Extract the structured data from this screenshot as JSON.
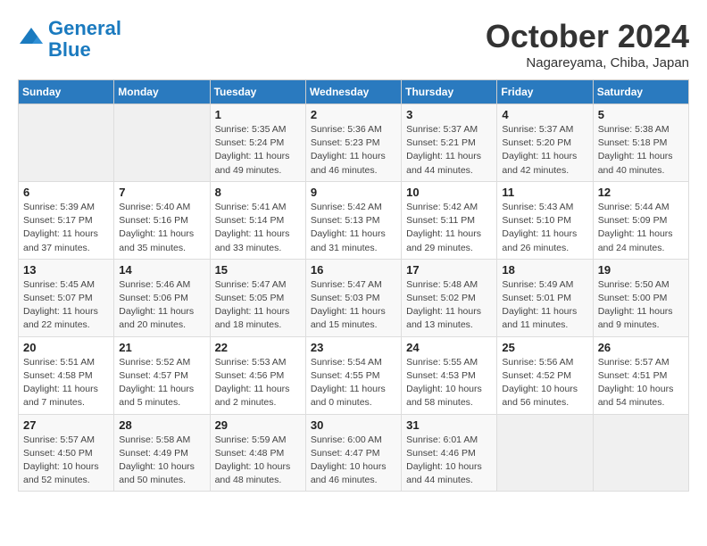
{
  "header": {
    "logo_line1": "General",
    "logo_line2": "Blue",
    "month": "October 2024",
    "location": "Nagareyama, Chiba, Japan"
  },
  "days_of_week": [
    "Sunday",
    "Monday",
    "Tuesday",
    "Wednesday",
    "Thursday",
    "Friday",
    "Saturday"
  ],
  "weeks": [
    [
      {
        "day": "",
        "info": ""
      },
      {
        "day": "",
        "info": ""
      },
      {
        "day": "1",
        "info": "Sunrise: 5:35 AM\nSunset: 5:24 PM\nDaylight: 11 hours and 49 minutes."
      },
      {
        "day": "2",
        "info": "Sunrise: 5:36 AM\nSunset: 5:23 PM\nDaylight: 11 hours and 46 minutes."
      },
      {
        "day": "3",
        "info": "Sunrise: 5:37 AM\nSunset: 5:21 PM\nDaylight: 11 hours and 44 minutes."
      },
      {
        "day": "4",
        "info": "Sunrise: 5:37 AM\nSunset: 5:20 PM\nDaylight: 11 hours and 42 minutes."
      },
      {
        "day": "5",
        "info": "Sunrise: 5:38 AM\nSunset: 5:18 PM\nDaylight: 11 hours and 40 minutes."
      }
    ],
    [
      {
        "day": "6",
        "info": "Sunrise: 5:39 AM\nSunset: 5:17 PM\nDaylight: 11 hours and 37 minutes."
      },
      {
        "day": "7",
        "info": "Sunrise: 5:40 AM\nSunset: 5:16 PM\nDaylight: 11 hours and 35 minutes."
      },
      {
        "day": "8",
        "info": "Sunrise: 5:41 AM\nSunset: 5:14 PM\nDaylight: 11 hours and 33 minutes."
      },
      {
        "day": "9",
        "info": "Sunrise: 5:42 AM\nSunset: 5:13 PM\nDaylight: 11 hours and 31 minutes."
      },
      {
        "day": "10",
        "info": "Sunrise: 5:42 AM\nSunset: 5:11 PM\nDaylight: 11 hours and 29 minutes."
      },
      {
        "day": "11",
        "info": "Sunrise: 5:43 AM\nSunset: 5:10 PM\nDaylight: 11 hours and 26 minutes."
      },
      {
        "day": "12",
        "info": "Sunrise: 5:44 AM\nSunset: 5:09 PM\nDaylight: 11 hours and 24 minutes."
      }
    ],
    [
      {
        "day": "13",
        "info": "Sunrise: 5:45 AM\nSunset: 5:07 PM\nDaylight: 11 hours and 22 minutes."
      },
      {
        "day": "14",
        "info": "Sunrise: 5:46 AM\nSunset: 5:06 PM\nDaylight: 11 hours and 20 minutes."
      },
      {
        "day": "15",
        "info": "Sunrise: 5:47 AM\nSunset: 5:05 PM\nDaylight: 11 hours and 18 minutes."
      },
      {
        "day": "16",
        "info": "Sunrise: 5:47 AM\nSunset: 5:03 PM\nDaylight: 11 hours and 15 minutes."
      },
      {
        "day": "17",
        "info": "Sunrise: 5:48 AM\nSunset: 5:02 PM\nDaylight: 11 hours and 13 minutes."
      },
      {
        "day": "18",
        "info": "Sunrise: 5:49 AM\nSunset: 5:01 PM\nDaylight: 11 hours and 11 minutes."
      },
      {
        "day": "19",
        "info": "Sunrise: 5:50 AM\nSunset: 5:00 PM\nDaylight: 11 hours and 9 minutes."
      }
    ],
    [
      {
        "day": "20",
        "info": "Sunrise: 5:51 AM\nSunset: 4:58 PM\nDaylight: 11 hours and 7 minutes."
      },
      {
        "day": "21",
        "info": "Sunrise: 5:52 AM\nSunset: 4:57 PM\nDaylight: 11 hours and 5 minutes."
      },
      {
        "day": "22",
        "info": "Sunrise: 5:53 AM\nSunset: 4:56 PM\nDaylight: 11 hours and 2 minutes."
      },
      {
        "day": "23",
        "info": "Sunrise: 5:54 AM\nSunset: 4:55 PM\nDaylight: 11 hours and 0 minutes."
      },
      {
        "day": "24",
        "info": "Sunrise: 5:55 AM\nSunset: 4:53 PM\nDaylight: 10 hours and 58 minutes."
      },
      {
        "day": "25",
        "info": "Sunrise: 5:56 AM\nSunset: 4:52 PM\nDaylight: 10 hours and 56 minutes."
      },
      {
        "day": "26",
        "info": "Sunrise: 5:57 AM\nSunset: 4:51 PM\nDaylight: 10 hours and 54 minutes."
      }
    ],
    [
      {
        "day": "27",
        "info": "Sunrise: 5:57 AM\nSunset: 4:50 PM\nDaylight: 10 hours and 52 minutes."
      },
      {
        "day": "28",
        "info": "Sunrise: 5:58 AM\nSunset: 4:49 PM\nDaylight: 10 hours and 50 minutes."
      },
      {
        "day": "29",
        "info": "Sunrise: 5:59 AM\nSunset: 4:48 PM\nDaylight: 10 hours and 48 minutes."
      },
      {
        "day": "30",
        "info": "Sunrise: 6:00 AM\nSunset: 4:47 PM\nDaylight: 10 hours and 46 minutes."
      },
      {
        "day": "31",
        "info": "Sunrise: 6:01 AM\nSunset: 4:46 PM\nDaylight: 10 hours and 44 minutes."
      },
      {
        "day": "",
        "info": ""
      },
      {
        "day": "",
        "info": ""
      }
    ]
  ]
}
